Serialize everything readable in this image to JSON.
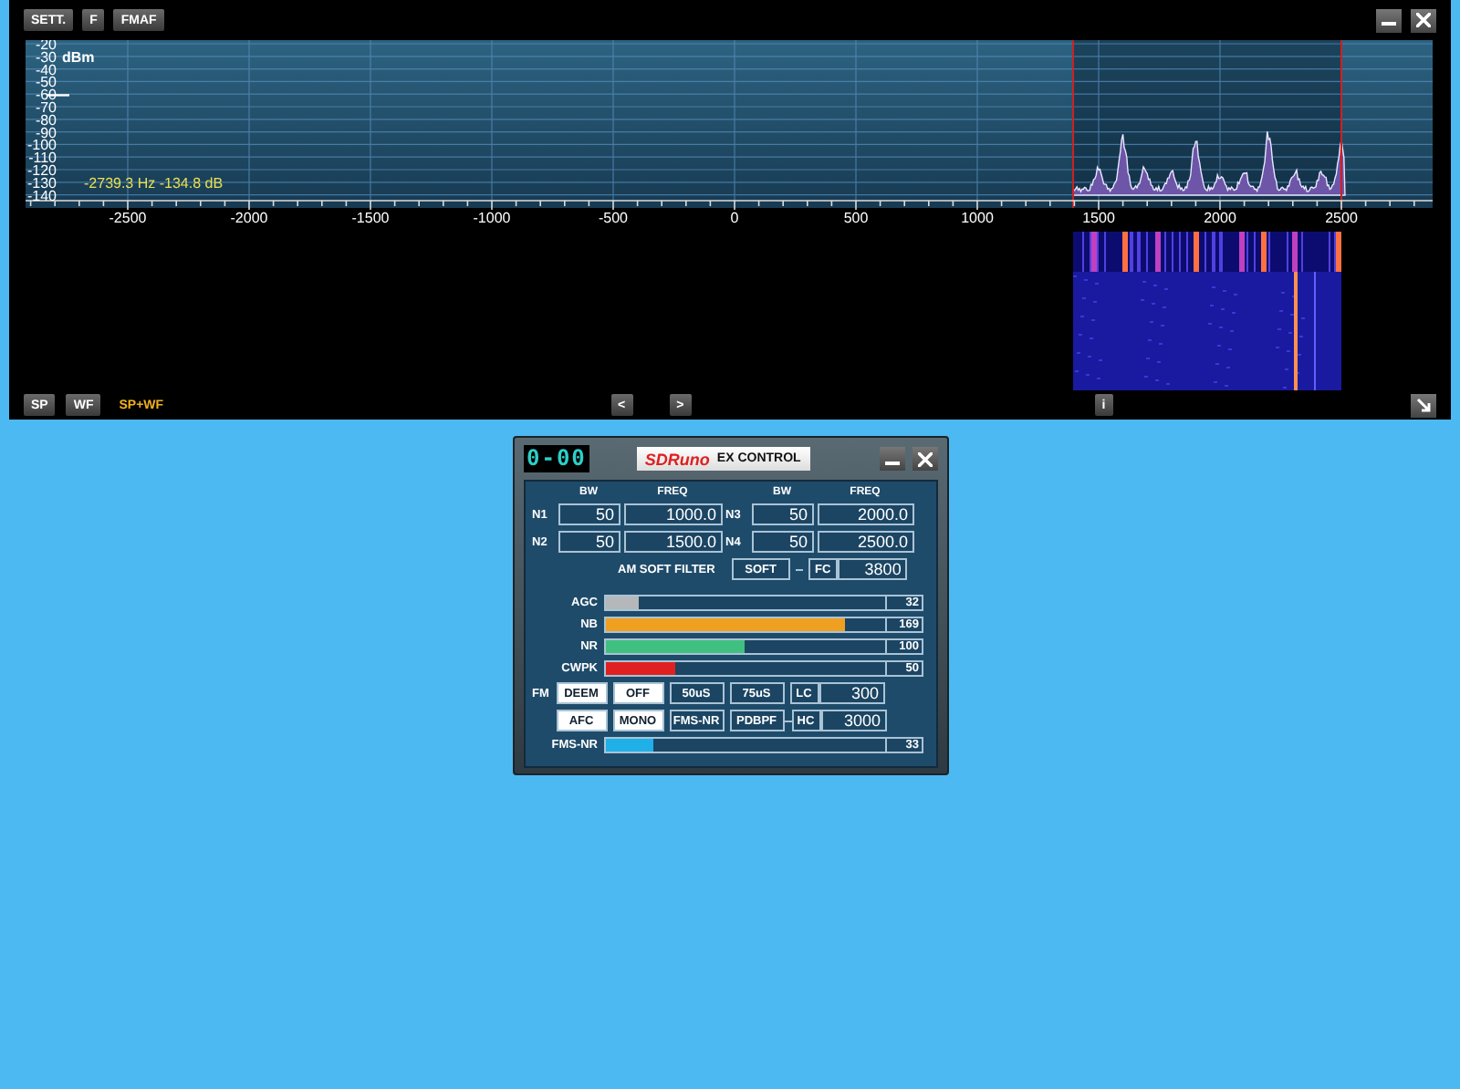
{
  "spectrum_window": {
    "toolbar": [
      {
        "label": "SETT."
      },
      {
        "label": "F"
      },
      {
        "label": "FMAF"
      }
    ],
    "y_labels": [
      "-20",
      "-30",
      "-40",
      "-50",
      "-60",
      "-70",
      "-80",
      "-90",
      "-100",
      "-110",
      "-120",
      "-130",
      "-140"
    ],
    "unit": "dBm",
    "x_labels": [
      "-2500",
      "-2000",
      "-1500",
      "-1000",
      "-500",
      "0",
      "500",
      "1000",
      "1500",
      "2000",
      "2500"
    ],
    "cursor_readout": "-2739.3 Hz -134.8 dB",
    "view_buttons": [
      {
        "label": "SP",
        "selected": false
      },
      {
        "label": "WF",
        "selected": false
      },
      {
        "label": "SP+WF",
        "selected": true
      }
    ],
    "nav_buttons": [
      "<",
      ">"
    ],
    "info_button": "i"
  },
  "ex_control": {
    "display": "0-00",
    "title_brand": "SDRuno",
    "title": "EX CONTROL",
    "notch_headers": [
      "BW",
      "FREQ",
      "BW",
      "FREQ"
    ],
    "notches": [
      {
        "label": "N1",
        "bw": "50",
        "freq": "1000.0"
      },
      {
        "label": "N3",
        "bw": "50",
        "freq": "2000.0"
      },
      {
        "label": "N2",
        "bw": "50",
        "freq": "1500.0"
      },
      {
        "label": "N4",
        "bw": "50",
        "freq": "2500.0"
      }
    ],
    "am_filter": {
      "label": "AM SOFT FILTER",
      "button": "SOFT",
      "fc_label": "FC",
      "fc_value": "3800"
    },
    "sliders": [
      {
        "label": "AGC",
        "level": 0.12,
        "value": "32",
        "color": "#b4b8ba"
      },
      {
        "label": "NB",
        "level": 0.86,
        "value": "169",
        "color": "#f0a020"
      },
      {
        "label": "NR",
        "level": 0.5,
        "value": "100",
        "color": "#40c080"
      },
      {
        "label": "CWPK",
        "level": 0.25,
        "value": "50",
        "color": "#e02020"
      }
    ],
    "fm": {
      "label": "FM",
      "buttons": [
        {
          "label": "DEEM",
          "on": true
        },
        {
          "label": "OFF",
          "on": true
        },
        {
          "label": "50uS",
          "on": false
        },
        {
          "label": "75uS",
          "on": false
        },
        {
          "label": "AFC",
          "on": true
        },
        {
          "label": "MONO",
          "on": true
        },
        {
          "label": "FMS-NR",
          "on": false
        },
        {
          "label": "PDBPF",
          "on": false
        }
      ],
      "lc_label": "LC",
      "lc_value": "300",
      "hc_label": "HC",
      "hc_value": "3000"
    },
    "fms_nr_slider": {
      "label": "FMS-NR",
      "level": 0.17,
      "value": "33",
      "color": "#20b0e8"
    }
  }
}
